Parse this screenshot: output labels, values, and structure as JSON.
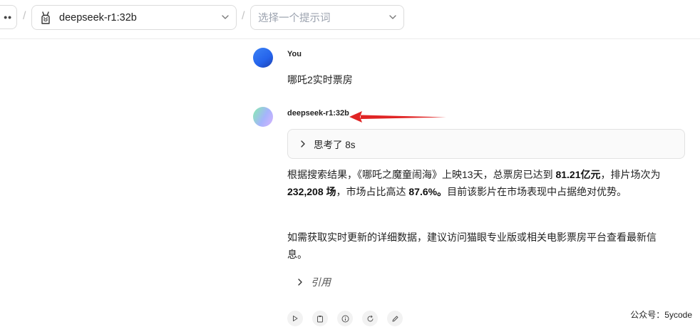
{
  "header": {
    "menu_icon": "ellipsis",
    "separator": "/",
    "model_select": {
      "icon": "llama-icon",
      "value": "deepseek-r1:32b"
    },
    "prompt_select": {
      "placeholder": "选择一个提示词"
    }
  },
  "conversation": {
    "user": {
      "name": "You",
      "message": "哪吒2实时票房"
    },
    "assistant": {
      "name": "deepseek-r1:32b",
      "thinking_label": "思考了 8s",
      "paragraph1": {
        "t1": "根据搜索结果，《哪吒之魔童闹海》上映13天，总票房已达到 ",
        "b1": "81.21亿元",
        "t2": "，排片场次为 ",
        "b2": "232,208 场",
        "t3": "，市场占比高达 ",
        "b3": "87.6%。",
        "t4": "目前该影片在市场表现中占据绝对优势。"
      },
      "paragraph2": "如需获取实时更新的详细数据，建议访问猫眼专业版或相关电影票房平台查看最新信息。",
      "citations_label": "引用"
    }
  },
  "watermark": "公众号：5ycode",
  "colors": {
    "arrow": "#e02424",
    "user_avatar": "#2563eb"
  }
}
